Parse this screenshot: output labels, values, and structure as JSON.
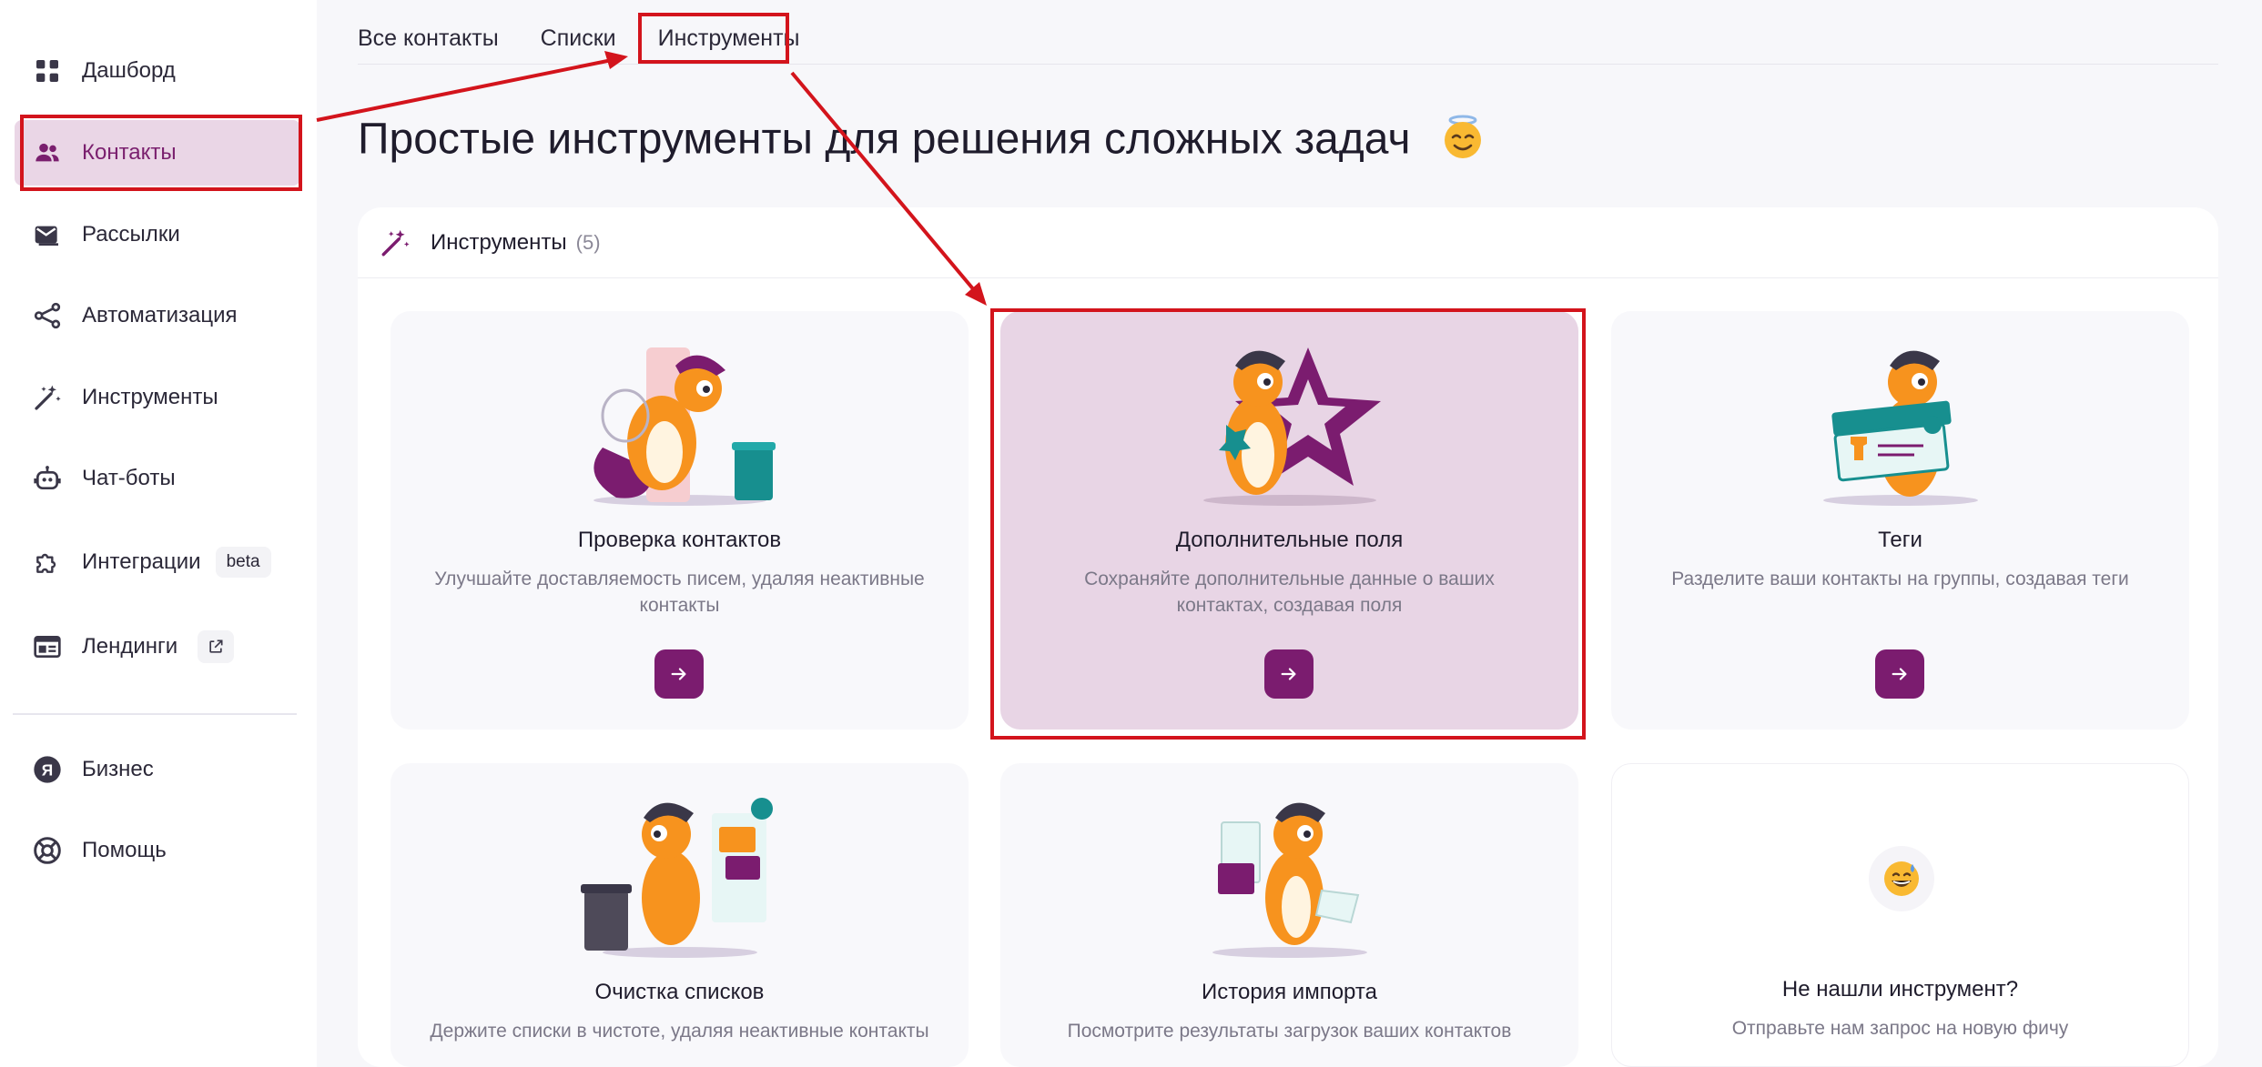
{
  "sidebar": {
    "items": [
      {
        "label": "Дашборд",
        "icon": "dashboard-icon"
      },
      {
        "label": "Контакты",
        "icon": "contacts-icon",
        "active": true
      },
      {
        "label": "Рассылки",
        "icon": "mail-icon"
      },
      {
        "label": "Автоматизация",
        "icon": "automation-icon"
      },
      {
        "label": "Инструменты",
        "icon": "magic-wand-icon"
      },
      {
        "label": "Чат-боты",
        "icon": "robot-icon"
      },
      {
        "label": "Интеграции",
        "icon": "puzzle-icon",
        "badge": "beta"
      },
      {
        "label": "Лендинги",
        "icon": "landing-icon",
        "external": true
      },
      {
        "label": "Бизнес",
        "icon": "yandex-business-icon"
      },
      {
        "label": "Помощь",
        "icon": "help-icon"
      }
    ]
  },
  "tabs": [
    {
      "label": "Все контакты"
    },
    {
      "label": "Списки"
    },
    {
      "label": "Инструменты",
      "active": true
    }
  ],
  "page": {
    "title": "Простые инструменты для решения сложных задач"
  },
  "panel": {
    "title": "Инструменты",
    "count": "(5)"
  },
  "cards": [
    {
      "title": "Проверка контактов",
      "desc": "Улучшайте доставляемость писем, удаляя неактивные контакты"
    },
    {
      "title": "Дополнительные поля",
      "desc": "Сохраняйте дополнительные данные о ваших контактах, создавая поля"
    },
    {
      "title": "Теги",
      "desc": "Разделите ваши контакты на группы, создавая теги"
    },
    {
      "title": "Очистка списков",
      "desc": "Держите списки в чистоте, удаляя неактивные контакты"
    },
    {
      "title": "История импорта",
      "desc": "Посмотрите результаты загрузок ваших контактов"
    },
    {
      "title": "Не нашли инструмент?",
      "desc": "Отправьте нам запрос на новую фичу"
    }
  ],
  "colors": {
    "accent": "#7b1c6f",
    "active_bg": "#ead6e6",
    "annotation_red": "#d3141c",
    "page_bg": "#f7f7fa"
  }
}
